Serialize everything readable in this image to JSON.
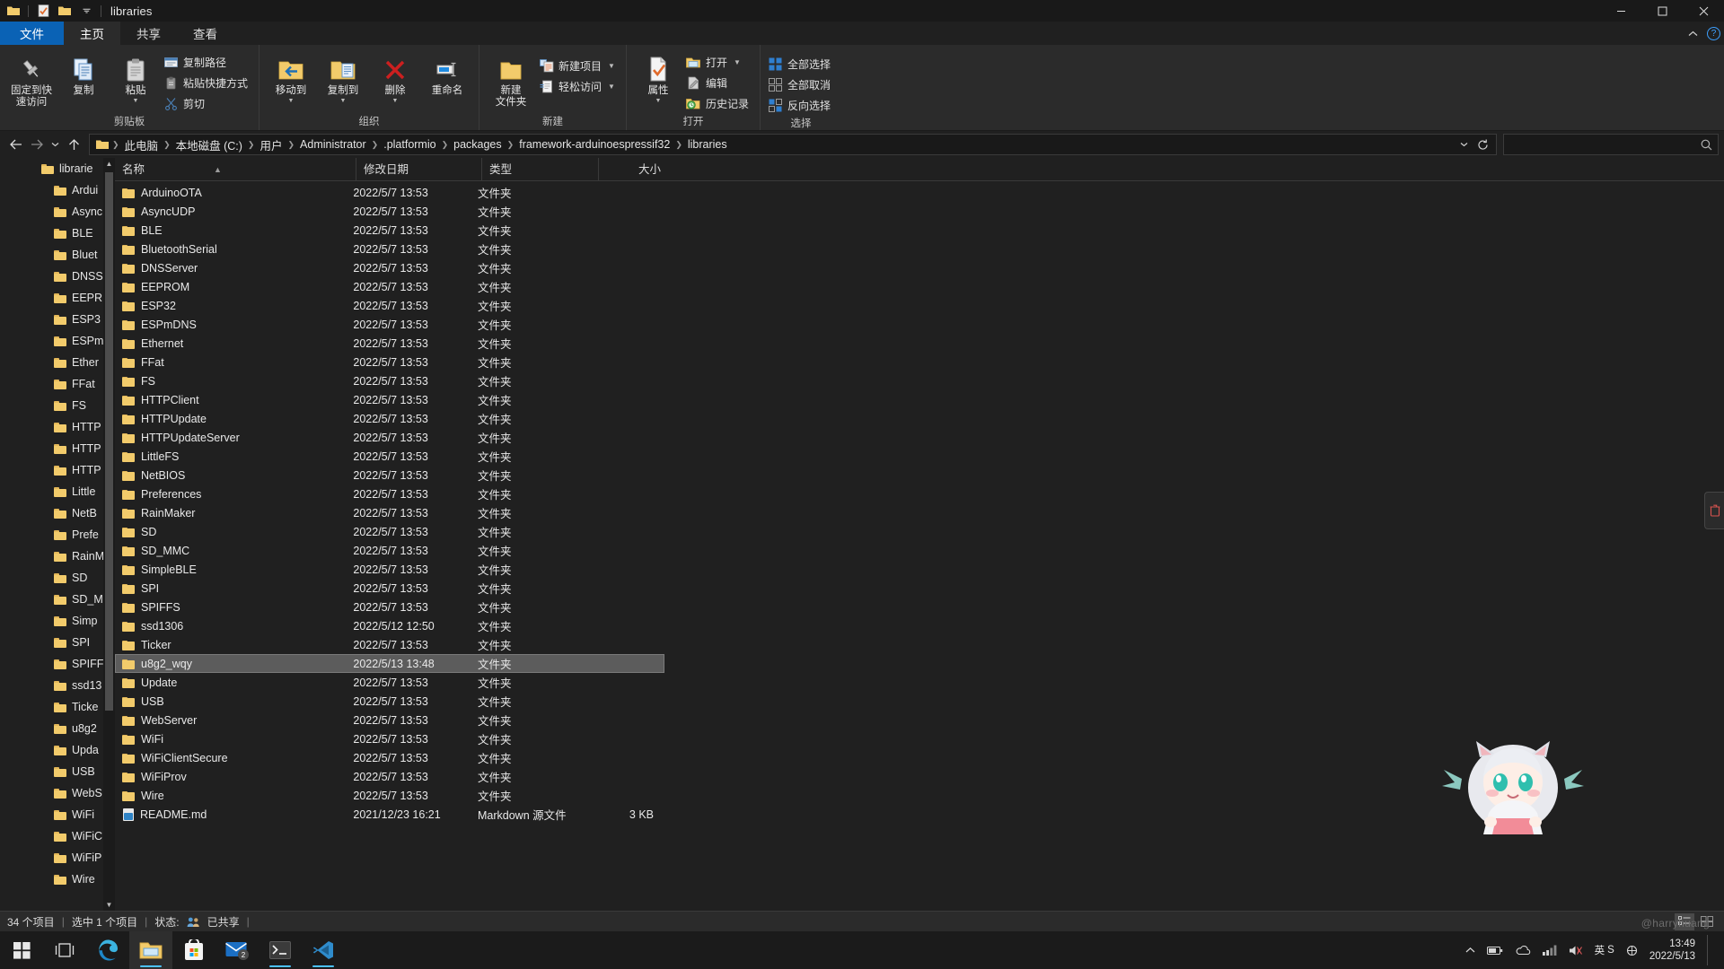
{
  "window": {
    "title": "libraries",
    "quick_access_icons": [
      "folder-icon",
      "properties-icon",
      "new-folder-icon",
      "customize-chevron-icon"
    ],
    "controls": {
      "minimize": "minimize-icon",
      "maximize": "maximize-icon",
      "close": "close-icon"
    }
  },
  "tabs": [
    {
      "id": "file",
      "label": "文件"
    },
    {
      "id": "home",
      "label": "主页"
    },
    {
      "id": "share",
      "label": "共享"
    },
    {
      "id": "view",
      "label": "查看"
    }
  ],
  "ribbon": {
    "collapse_icon": "chevron-up-icon",
    "help_label": "?",
    "groups": [
      {
        "id": "clipboard",
        "label": "剪贴板",
        "big_buttons": [
          {
            "label_line1": "固定到快",
            "label_line2": "速访问",
            "icon": "pin-icon"
          },
          {
            "label_line1": "复制",
            "label_line2": "",
            "icon": "copy-icon"
          },
          {
            "label_line1": "粘贴",
            "label_line2": "",
            "icon": "paste-icon",
            "has_caret": true
          }
        ],
        "small_buttons": [
          {
            "label": "复制路径",
            "icon": "copy-path-icon"
          },
          {
            "label": "粘贴快捷方式",
            "icon": "paste-shortcut-icon"
          },
          {
            "label": "剪切",
            "icon": "scissors-icon"
          }
        ]
      },
      {
        "id": "organize",
        "label": "组织",
        "big_buttons": [
          {
            "label_line1": "移动到",
            "label_line2": "",
            "icon": "move-to-icon",
            "has_caret": true
          },
          {
            "label_line1": "复制到",
            "label_line2": "",
            "icon": "copy-to-icon",
            "has_caret": true
          },
          {
            "label_line1": "删除",
            "label_line2": "",
            "icon": "delete-icon",
            "has_caret": true
          },
          {
            "label_line1": "重命名",
            "label_line2": "",
            "icon": "rename-icon"
          }
        ],
        "small_buttons": []
      },
      {
        "id": "new",
        "label": "新建",
        "big_buttons": [
          {
            "label_line1": "新建",
            "label_line2": "文件夹",
            "icon": "new-folder-icon"
          }
        ],
        "small_buttons": [
          {
            "label": "新建项目",
            "icon": "new-item-icon",
            "has_caret": true
          },
          {
            "label": "轻松访问",
            "icon": "easy-access-icon",
            "has_caret": true
          }
        ]
      },
      {
        "id": "open",
        "label": "打开",
        "big_buttons": [
          {
            "label_line1": "属性",
            "label_line2": "",
            "icon": "properties-icon",
            "has_caret": true
          }
        ],
        "small_buttons": [
          {
            "label": "打开",
            "icon": "open-icon",
            "has_caret": true
          },
          {
            "label": "编辑",
            "icon": "edit-icon"
          },
          {
            "label": "历史记录",
            "icon": "history-icon"
          }
        ]
      },
      {
        "id": "select",
        "label": "选择",
        "big_buttons": [],
        "small_buttons": [
          {
            "label": "全部选择",
            "icon": "select-all-icon"
          },
          {
            "label": "全部取消",
            "icon": "select-none-icon"
          },
          {
            "label": "反向选择",
            "icon": "invert-selection-icon"
          }
        ]
      }
    ]
  },
  "address": {
    "back_icon": "arrow-left-icon",
    "forward_icon": "arrow-right-icon",
    "recent_icon": "chevron-down-icon",
    "up_icon": "arrow-up-icon",
    "crumbs": [
      "此电脑",
      "本地磁盘 (C:)",
      "用户",
      "Administrator",
      ".platformio",
      "packages",
      "framework-arduinoespressif32",
      "libraries"
    ],
    "dropdown_icon": "chevron-down-icon",
    "refresh_icon": "refresh-icon",
    "search_placeholder": "",
    "search_icon": "search-icon"
  },
  "navpane": {
    "scroll_up_icon": "chevron-up-icon",
    "scroll_down_icon": "chevron-down-icon",
    "items": [
      "librarie",
      "Ardui",
      "Async",
      "BLE",
      "Bluet",
      "DNSS",
      "EEPR",
      "ESP3",
      "ESPm",
      "Ether",
      "FFat",
      "FS",
      "HTTP",
      "HTTP",
      "HTTP",
      "Little",
      "NetB",
      "Prefe",
      "RainM",
      "SD",
      "SD_M",
      "Simp",
      "SPI",
      "SPIFF",
      "ssd13",
      "Ticke",
      "u8g2",
      "Upda",
      "USB",
      "WebS",
      "WiFi",
      "WiFiC",
      "WiFiP",
      "Wire"
    ]
  },
  "columns": [
    {
      "key": "name",
      "label": "名称",
      "sorted": true
    },
    {
      "key": "date",
      "label": "修改日期"
    },
    {
      "key": "type",
      "label": "类型"
    },
    {
      "key": "size",
      "label": "大小"
    }
  ],
  "files": [
    {
      "name": "ArduinoOTA",
      "date": "2022/5/7 13:53",
      "type": "文件夹",
      "size": "",
      "icon": "folder-icon",
      "selected": false
    },
    {
      "name": "AsyncUDP",
      "date": "2022/5/7 13:53",
      "type": "文件夹",
      "size": "",
      "icon": "folder-icon",
      "selected": false
    },
    {
      "name": "BLE",
      "date": "2022/5/7 13:53",
      "type": "文件夹",
      "size": "",
      "icon": "folder-icon",
      "selected": false
    },
    {
      "name": "BluetoothSerial",
      "date": "2022/5/7 13:53",
      "type": "文件夹",
      "size": "",
      "icon": "folder-icon",
      "selected": false
    },
    {
      "name": "DNSServer",
      "date": "2022/5/7 13:53",
      "type": "文件夹",
      "size": "",
      "icon": "folder-icon",
      "selected": false
    },
    {
      "name": "EEPROM",
      "date": "2022/5/7 13:53",
      "type": "文件夹",
      "size": "",
      "icon": "folder-icon",
      "selected": false
    },
    {
      "name": "ESP32",
      "date": "2022/5/7 13:53",
      "type": "文件夹",
      "size": "",
      "icon": "folder-icon",
      "selected": false
    },
    {
      "name": "ESPmDNS",
      "date": "2022/5/7 13:53",
      "type": "文件夹",
      "size": "",
      "icon": "folder-icon",
      "selected": false
    },
    {
      "name": "Ethernet",
      "date": "2022/5/7 13:53",
      "type": "文件夹",
      "size": "",
      "icon": "folder-icon",
      "selected": false
    },
    {
      "name": "FFat",
      "date": "2022/5/7 13:53",
      "type": "文件夹",
      "size": "",
      "icon": "folder-icon",
      "selected": false
    },
    {
      "name": "FS",
      "date": "2022/5/7 13:53",
      "type": "文件夹",
      "size": "",
      "icon": "folder-icon",
      "selected": false
    },
    {
      "name": "HTTPClient",
      "date": "2022/5/7 13:53",
      "type": "文件夹",
      "size": "",
      "icon": "folder-icon",
      "selected": false
    },
    {
      "name": "HTTPUpdate",
      "date": "2022/5/7 13:53",
      "type": "文件夹",
      "size": "",
      "icon": "folder-icon",
      "selected": false
    },
    {
      "name": "HTTPUpdateServer",
      "date": "2022/5/7 13:53",
      "type": "文件夹",
      "size": "",
      "icon": "folder-icon",
      "selected": false
    },
    {
      "name": "LittleFS",
      "date": "2022/5/7 13:53",
      "type": "文件夹",
      "size": "",
      "icon": "folder-icon",
      "selected": false
    },
    {
      "name": "NetBIOS",
      "date": "2022/5/7 13:53",
      "type": "文件夹",
      "size": "",
      "icon": "folder-icon",
      "selected": false
    },
    {
      "name": "Preferences",
      "date": "2022/5/7 13:53",
      "type": "文件夹",
      "size": "",
      "icon": "folder-icon",
      "selected": false
    },
    {
      "name": "RainMaker",
      "date": "2022/5/7 13:53",
      "type": "文件夹",
      "size": "",
      "icon": "folder-icon",
      "selected": false
    },
    {
      "name": "SD",
      "date": "2022/5/7 13:53",
      "type": "文件夹",
      "size": "",
      "icon": "folder-icon",
      "selected": false
    },
    {
      "name": "SD_MMC",
      "date": "2022/5/7 13:53",
      "type": "文件夹",
      "size": "",
      "icon": "folder-icon",
      "selected": false
    },
    {
      "name": "SimpleBLE",
      "date": "2022/5/7 13:53",
      "type": "文件夹",
      "size": "",
      "icon": "folder-icon",
      "selected": false
    },
    {
      "name": "SPI",
      "date": "2022/5/7 13:53",
      "type": "文件夹",
      "size": "",
      "icon": "folder-icon",
      "selected": false
    },
    {
      "name": "SPIFFS",
      "date": "2022/5/7 13:53",
      "type": "文件夹",
      "size": "",
      "icon": "folder-icon",
      "selected": false
    },
    {
      "name": "ssd1306",
      "date": "2022/5/12 12:50",
      "type": "文件夹",
      "size": "",
      "icon": "folder-icon",
      "selected": false
    },
    {
      "name": "Ticker",
      "date": "2022/5/7 13:53",
      "type": "文件夹",
      "size": "",
      "icon": "folder-icon",
      "selected": false
    },
    {
      "name": "u8g2_wqy",
      "date": "2022/5/13 13:48",
      "type": "文件夹",
      "size": "",
      "icon": "folder-icon",
      "selected": true
    },
    {
      "name": "Update",
      "date": "2022/5/7 13:53",
      "type": "文件夹",
      "size": "",
      "icon": "folder-icon",
      "selected": false
    },
    {
      "name": "USB",
      "date": "2022/5/7 13:53",
      "type": "文件夹",
      "size": "",
      "icon": "folder-icon",
      "selected": false
    },
    {
      "name": "WebServer",
      "date": "2022/5/7 13:53",
      "type": "文件夹",
      "size": "",
      "icon": "folder-icon",
      "selected": false
    },
    {
      "name": "WiFi",
      "date": "2022/5/7 13:53",
      "type": "文件夹",
      "size": "",
      "icon": "folder-icon",
      "selected": false
    },
    {
      "name": "WiFiClientSecure",
      "date": "2022/5/7 13:53",
      "type": "文件夹",
      "size": "",
      "icon": "folder-icon",
      "selected": false
    },
    {
      "name": "WiFiProv",
      "date": "2022/5/7 13:53",
      "type": "文件夹",
      "size": "",
      "icon": "folder-icon",
      "selected": false
    },
    {
      "name": "Wire",
      "date": "2022/5/7 13:53",
      "type": "文件夹",
      "size": "",
      "icon": "folder-icon",
      "selected": false
    },
    {
      "name": "README.md",
      "date": "2021/12/23 16:21",
      "type": "Markdown 源文件",
      "size": "3 KB",
      "icon": "markdown-file-icon",
      "selected": false
    }
  ],
  "statusbar": {
    "item_count": "34 个项目",
    "selection": "选中 1 个项目",
    "state_label": "状态:",
    "state_value": "已共享",
    "state_icon": "shared-people-icon",
    "view_details_icon": "details-view-icon",
    "view_tiles_icon": "large-icons-view-icon"
  },
  "taskbar": {
    "items": [
      {
        "id": "start",
        "icon": "windows-start-icon",
        "active": false,
        "running": false,
        "badge": ""
      },
      {
        "id": "taskview",
        "icon": "task-view-icon",
        "active": false,
        "running": false,
        "badge": ""
      },
      {
        "id": "edge",
        "icon": "edge-browser-icon",
        "active": false,
        "running": true,
        "badge": ""
      },
      {
        "id": "explorer",
        "icon": "file-explorer-icon",
        "active": true,
        "running": true,
        "badge": ""
      },
      {
        "id": "store",
        "icon": "microsoft-store-icon",
        "active": false,
        "running": false,
        "badge": ""
      },
      {
        "id": "mail",
        "icon": "mail-icon",
        "active": false,
        "running": false,
        "badge": "2"
      },
      {
        "id": "terminal",
        "icon": "terminal-icon",
        "active": false,
        "running": true,
        "badge": ""
      },
      {
        "id": "vscode",
        "icon": "vscode-icon",
        "active": false,
        "running": true,
        "badge": ""
      }
    ],
    "tray": {
      "chevron_icon": "chevron-up-icon",
      "icons": [
        "battery-icon",
        "onedrive-icon",
        "network-icon",
        "volume-icon",
        "ime-icon"
      ],
      "ime_label": "英",
      "ime_mode": "S",
      "time": "13:49",
      "date": "2022/5/13"
    }
  },
  "desktop": {
    "watermark": "@harryhuang",
    "mascot_alt": "anime-mascot-sticker",
    "edge_widget_icon": "bin-icon"
  }
}
